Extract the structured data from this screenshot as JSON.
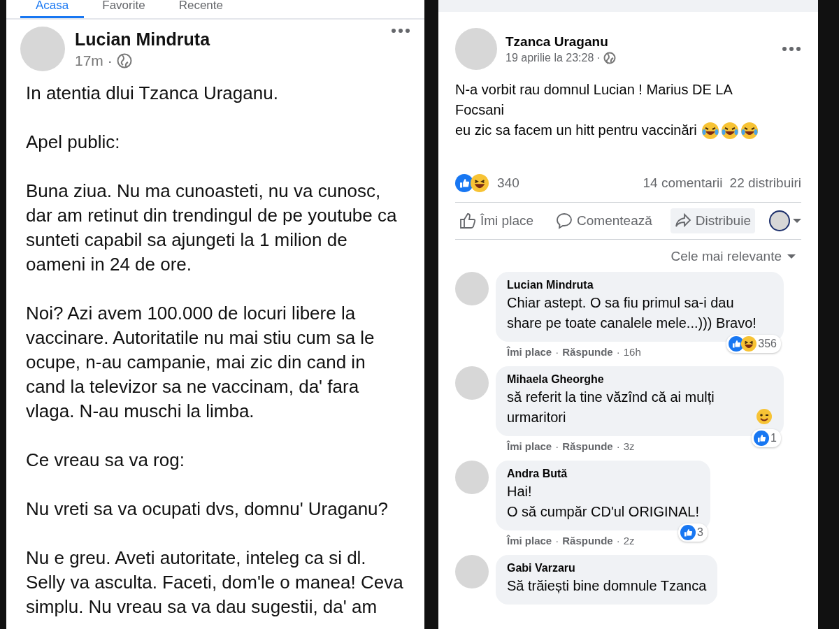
{
  "left_post": {
    "tabs": [
      {
        "label": "Acasa",
        "selected": true
      },
      {
        "label": "Favorite",
        "selected": false
      },
      {
        "label": "Recente",
        "selected": false
      }
    ],
    "author": "Lucian Mindruta",
    "time": "17m",
    "separator": "·",
    "paragraphs": [
      "In atentia dlui Tzanca Uraganu.",
      "Apel public:",
      "Buna ziua. Nu ma cunoasteti, nu va cunosc, dar am retinut din trendingul de pe youtube ca sunteti capabil sa ajungeti la 1 milion de oameni in 24 de ore.",
      "Noi? Azi avem 100.000 de locuri libere la vaccinare. Autoritatile nu mai stiu cum sa le ocupe, n-au campanie, mai zic din cand in cand la televizor sa ne vaccinam, da' fara vlaga. N-au muschi la limba.",
      "Ce vreau sa va rog:",
      "Nu vreti sa va ocupati dvs, domnu' Uraganu?",
      "Nu e greu. Aveti autoritate, inteleg ca si dl. Selly va asculta. Faceti, dom'le o manea! Ceva simplu. Nu vreau sa va dau sugestii, da' am"
    ]
  },
  "right_post": {
    "author": "Tzanca Uraganu",
    "time": "19 aprilie la 23:28",
    "separator": "·",
    "text_lines": [
      "N-a vorbit rau domnul Lucian ! Marius DE LA Focsani",
      "eu zic sa facem un hitt pentru vaccinări"
    ],
    "reactions": [
      {
        "kind": "like"
      },
      {
        "kind": "haha"
      }
    ],
    "reaction_count": "340",
    "comments_count": "14 comentarii",
    "shares_count": "22 distribuiri",
    "actions": [
      {
        "label": "Îmi place",
        "kind": "like",
        "highlighted": false
      },
      {
        "label": "Comentează",
        "kind": "comment",
        "highlighted": false
      },
      {
        "label": "Distribuie",
        "kind": "share",
        "highlighted": true
      }
    ],
    "sort": "Cele mai relevante",
    "comments": [
      {
        "author": "Lucian Mindruta",
        "text": "Chiar astept. O sa fiu primul sa-i dau share pe toate canalele mele...))) Bravo!",
        "emoji": false,
        "reactions": [
          {
            "kind": "like"
          },
          {
            "kind": "haha"
          }
        ],
        "reaction_count": "356",
        "actions": [
          "Îmi place",
          "Răspunde"
        ],
        "time": "16h"
      },
      {
        "author": "Mihaela Gheorghe",
        "text": "să referit la tine văzînd că ai mulți urmaritori",
        "emoji": true,
        "reactions": [
          {
            "kind": "like"
          }
        ],
        "reaction_count": "1",
        "actions": [
          "Îmi place",
          "Răspunde"
        ],
        "time": "3z"
      },
      {
        "author": "Andra Bută",
        "text": "Hai!\nO să cumpăr CD'ul ORIGINAL!",
        "emoji": false,
        "reactions": [
          {
            "kind": "like"
          }
        ],
        "reaction_count": "3",
        "actions": [
          "Îmi place",
          "Răspunde"
        ],
        "time": "2z"
      },
      {
        "author": "Gabi Varzaru",
        "text": "Să trăiești bine domnule Tzanca",
        "emoji": false
      }
    ]
  }
}
